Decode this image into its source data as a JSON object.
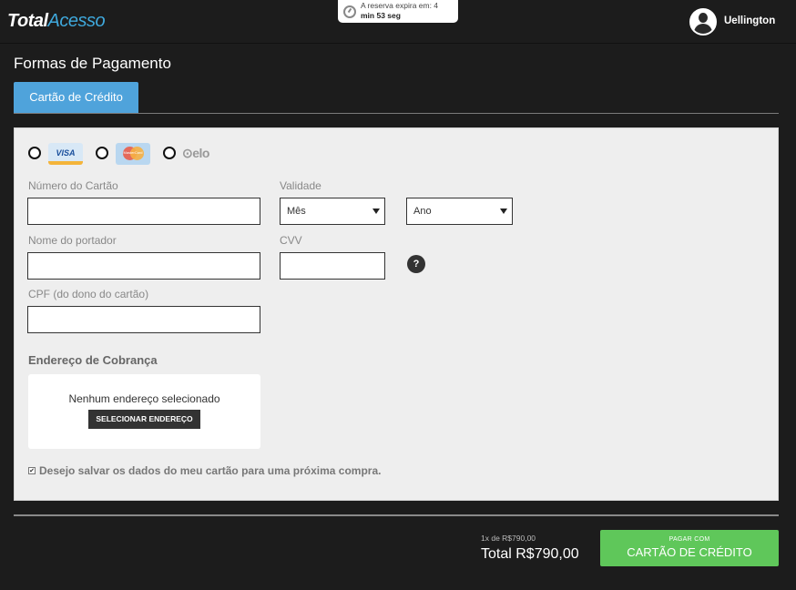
{
  "header": {
    "logo_part1": "Total",
    "logo_part2": "Acesso",
    "timer_text": "A reserva expira em: 4",
    "timer_text_bold": "min 53 seg",
    "user_name": "Uellington"
  },
  "page_title": "Formas de Pagamento",
  "tab_label": "Cartão de Crédito",
  "card_brands": {
    "visa": "VISA",
    "mastercard": "MasterCard",
    "elo": "elo"
  },
  "form": {
    "card_number_label": "Número do Cartão",
    "validity_label": "Validade",
    "month_select": "Mês",
    "year_select": "Ano",
    "holder_label": "Nome do portador",
    "cvv_label": "CVV",
    "help_glyph": "?",
    "cpf_label": "CPF (do dono do cartão)"
  },
  "billing": {
    "title": "Endereço de Cobrança",
    "empty_message": "Nenhum endereço selecionado",
    "select_button": "SELECIONAR ENDEREÇO"
  },
  "save_checkbox_label": "Desejo salvar os dados do meu cartão para uma próxima compra.",
  "summary": {
    "installment": "1x de R$790,00",
    "total": "Total R$790,00"
  },
  "pay_button": {
    "small": "PAGAR COM",
    "big": "CARTÃO DE CRÉDITO"
  },
  "colors": {
    "accent_tab": "#4fa3db",
    "pay_button": "#5fc75a",
    "background": "#1c1c1c"
  }
}
